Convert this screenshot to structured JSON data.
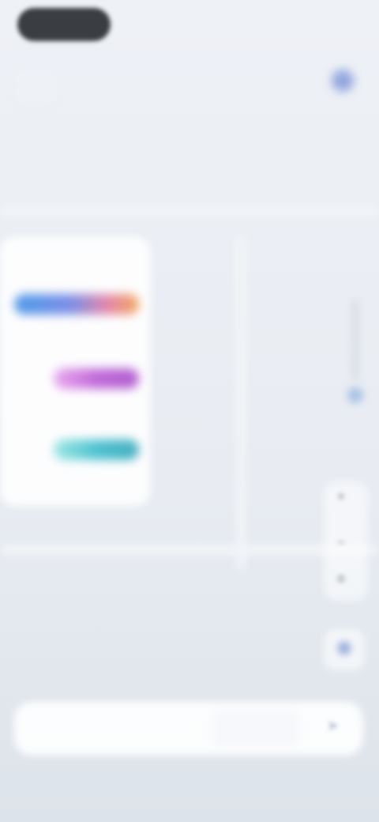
{
  "status_bar": {
    "time": "",
    "right": ""
  },
  "topbar": {
    "title": "",
    "subtitle": ""
  },
  "map": {
    "labels": [
      "",
      "",
      "",
      "",
      "",
      "",
      "",
      "",
      ""
    ]
  },
  "legend": {
    "title": "",
    "rows": [
      {
        "label": "",
        "gradient": [
          "#4f9be9",
          "#7a8ee6",
          "#e586a8",
          "#f2a65c"
        ]
      },
      {
        "label": "",
        "gradient": [
          "#e9a7ef",
          "#c26ad9",
          "#b05fcf"
        ]
      },
      {
        "label": "",
        "gradient": [
          "#9ee7e3",
          "#4fc2d1",
          "#46aebf"
        ]
      }
    ],
    "footer": ""
  },
  "controls": {
    "zoom_in": "+",
    "zoom_out": "−",
    "layers": "≡"
  },
  "bottom": {
    "search_text": "",
    "action_label": "",
    "send_icon": "send-icon"
  },
  "colors": {
    "accent": "#7386c9",
    "location": "#7c93d8",
    "background": "#eef1f6"
  }
}
